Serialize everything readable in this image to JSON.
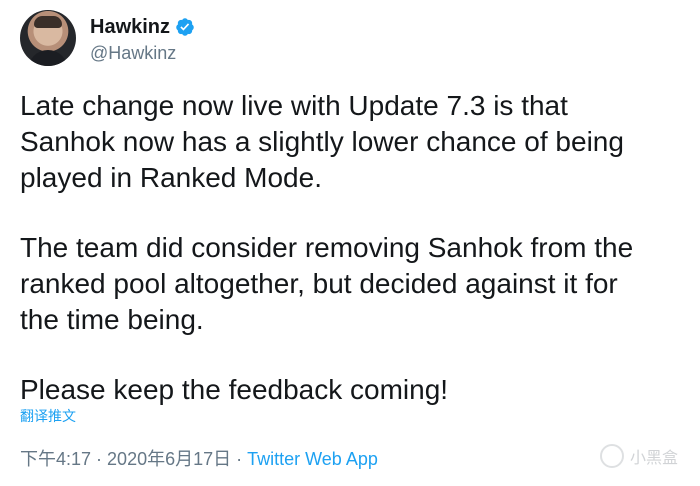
{
  "author": {
    "display_name": "Hawkinz",
    "handle": "@Hawkinz",
    "verified": true
  },
  "tweet": {
    "paragraphs": [
      "Late change now live with Update 7.3 is that\nSanhok now has a slightly lower chance of being\nplayed in Ranked Mode.",
      "The team did consider removing Sanhok from the\nranked pool altogether, but decided against it for\nthe time being.",
      "Please keep the feedback coming!"
    ],
    "translate_label": "翻译推文"
  },
  "meta": {
    "time": "下午4:17",
    "separator": "·",
    "date": "2020年6月17日",
    "source": "Twitter Web App"
  },
  "watermark": {
    "text": "小黑盒"
  },
  "colors": {
    "accent": "#1da1f2",
    "text": "#14171a",
    "muted": "#657786"
  }
}
